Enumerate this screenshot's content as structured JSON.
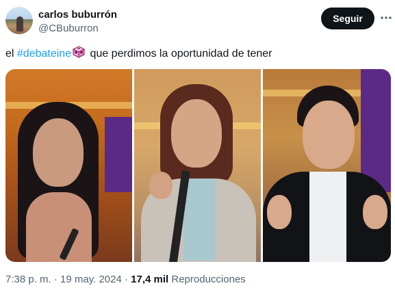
{
  "author": {
    "name": "carlos buburrón",
    "handle": "@CBuburron"
  },
  "follow_button": {
    "label": "Seguir"
  },
  "tweet": {
    "text_before": "el ",
    "hashtag": "#debateine",
    "emoji_icon": "ballot-box-icon",
    "text_after": " que perdimos la oportunidad de tener"
  },
  "media": {
    "panels": [
      {
        "name": "panel-left"
      },
      {
        "name": "panel-center"
      },
      {
        "name": "panel-right"
      }
    ]
  },
  "meta": {
    "time": "7:38 p. m.",
    "sep1": " · ",
    "date": "19 may. 2024",
    "sep2": " · ",
    "views_count": "17,4 mil",
    "views_label": " Reproducciones"
  },
  "colors": {
    "link": "#1d9bf0",
    "text": "#0f1419",
    "secondary": "#536471",
    "button_bg": "#0f1419"
  }
}
